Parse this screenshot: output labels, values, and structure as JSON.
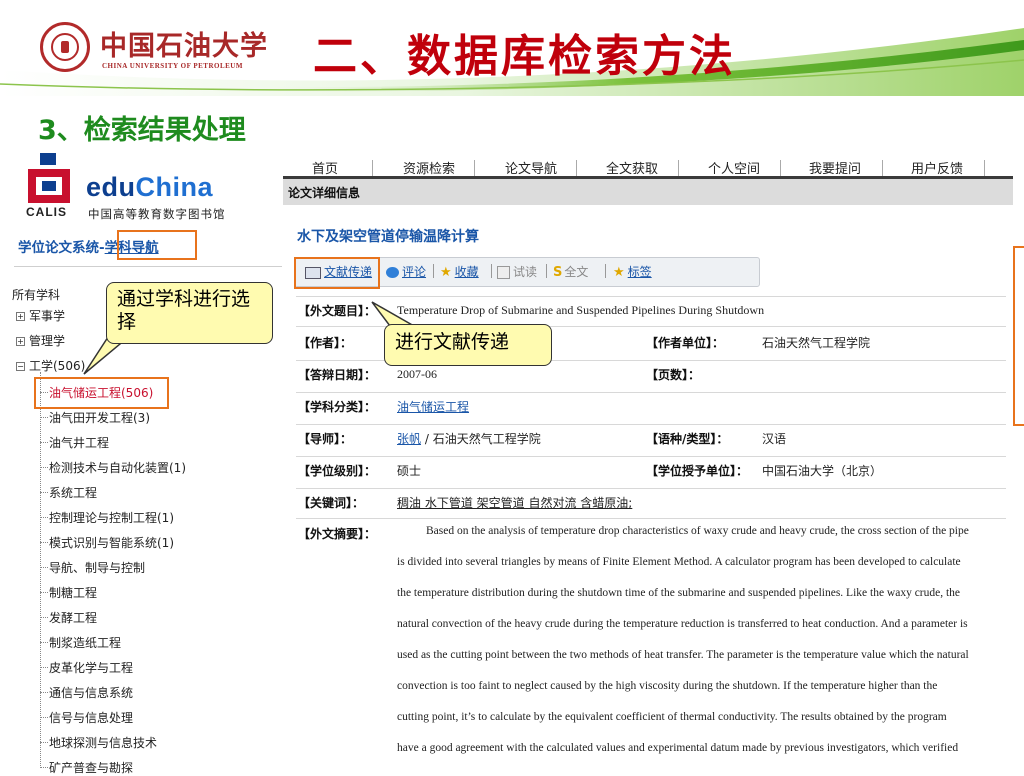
{
  "slide": {
    "university_cn": "中国石油大学",
    "university_en": "CHINA UNIVERSITY OF PETROLEUM",
    "title": "二、数据库检索方法",
    "subtitle": "3、检索结果处理"
  },
  "left": {
    "calis_label": "CALIS",
    "brand_edu": "edu",
    "brand_china": "China",
    "brand_sub": "中国高等教育数字图书馆",
    "nav_title_prefix": "学位论文系统-",
    "nav_title_link": "学科导航",
    "tree_root": "所有学科",
    "groups": [
      {
        "label": "军事学",
        "toggle": "+"
      },
      {
        "label": "管理学",
        "toggle": "+"
      },
      {
        "label": "工学(506)",
        "toggle": "−"
      }
    ],
    "leaves": [
      "油气储运工程(506)",
      "油气田开发工程(3)",
      "油气井工程",
      "检测技术与自动化装置(1)",
      "系统工程",
      "控制理论与控制工程(1)",
      "模式识别与智能系统(1)",
      "导航、制导与控制",
      "制糖工程",
      "发酵工程",
      "制浆造纸工程",
      "皮革化学与工程",
      "通信与信息系统",
      "信号与信息处理",
      "地球探测与信息技术",
      "矿产普查与勘探"
    ]
  },
  "callouts": {
    "subject": "通过学科进行选择",
    "delivery": "进行文献传递"
  },
  "menu": [
    "首页",
    "资源检索",
    "论文导航",
    "全文获取",
    "个人空间",
    "我要提问",
    "用户反馈"
  ],
  "detail": {
    "header": "论文详细信息",
    "paper_title": "水下及架空管道停输温降计算",
    "toolbar": {
      "delivery": "文献传递",
      "comment": "评论",
      "favorite": "收藏",
      "trial_read": "试读",
      "full_text": "全文",
      "tag": "标签"
    },
    "fields": {
      "foreign_title_label": "【外文题目】：",
      "foreign_title": "Temperature Drop of Submarine and Suspended Pipelines During Shutdown",
      "author_label": "【作者】：",
      "author_unit_label": "【作者单位】：",
      "author_unit": "石油天然气工程学院",
      "defense_date_label": "【答辩日期】：",
      "defense_date": "2007-06",
      "pages_label": "【页数】：",
      "category_label": "【学科分类】：",
      "category": "油气储运工程",
      "advisor_label": "【导师】：",
      "advisor_name": "张帆",
      "advisor_unit": " / 石油天然气工程学院",
      "language_label": "【语种/类型】：",
      "language": "汉语",
      "degree_label": "【学位级别】：",
      "degree": "硕士",
      "grant_unit_label": "【学位授予单位】：",
      "grant_unit": "中国石油大学（北京）",
      "keywords_label": "【关键词】：",
      "keywords": "稠油 水下管道 架空管道 自然对流 含蜡原油;",
      "abstract_label": "【外文摘要】："
    },
    "abstract_lines": [
      "Based on the analysis of temperature drop characteristics of waxy crude and heavy crude, the cross section of the pipe",
      "is divided into several triangles by means of Finite Element Method. A calculator program has been developed to calculate",
      "the temperature distribution during the shutdown time of the submarine and suspended pipelines. Like the waxy crude, the",
      "natural convection of the heavy crude during the temperature reduction is transferred to heat conduction. And a parameter is",
      "used as the cutting point between the two methods of heat transfer. The parameter is the temperature value which the natural",
      "convection is too faint to neglect caused by the high viscosity during the shutdown. If the temperature higher than the",
      "cutting point, it’s to calculate by the equivalent coefficient of thermal conductivity. The results obtained by the program",
      "have a good agreement with the calculated values and experimental datum made by previous investigators, which verified"
    ]
  },
  "colors": {
    "title_red": "#c0000b",
    "subtitle_green": "#1e8b1e",
    "highlight_orange": "#e8731c",
    "callout_fill": "#fffbb0",
    "link_blue": "#1a56a8"
  }
}
